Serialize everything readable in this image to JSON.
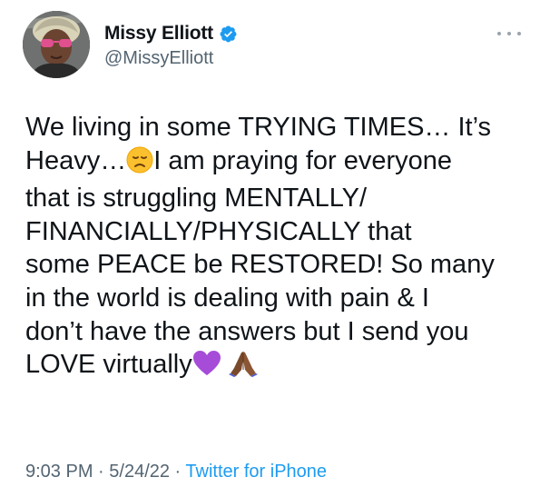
{
  "author": {
    "display_name": "Missy Elliott",
    "handle": "@MissyElliott",
    "verified": true
  },
  "tweet": {
    "line1": "We living in some TRYING TIMES… It’s",
    "line2_a": "Heavy…",
    "line2_b": "I am praying for everyone",
    "line3": "that is struggling MENTALLY/",
    "line4": "FINANCIALLY/PHYSICALLY that",
    "line5": "some PEACE be RESTORED! So many",
    "line6": "in the world is dealing with pain & I",
    "line7": "don’t have the answers but I send you",
    "line8": "LOVE virtually",
    "emojis": [
      "disappointed-face-emoji",
      "purple-heart-emoji",
      "folded-hands-emoji"
    ]
  },
  "meta": {
    "time": "9:03 PM",
    "separator1": " · ",
    "date": "5/24/22",
    "separator2": " · ",
    "source": "Twitter for iPhone"
  },
  "colors": {
    "text": "#0f1419",
    "secondary": "#536471",
    "link": "#1d9bf0",
    "verified": "#1d9bf0"
  }
}
